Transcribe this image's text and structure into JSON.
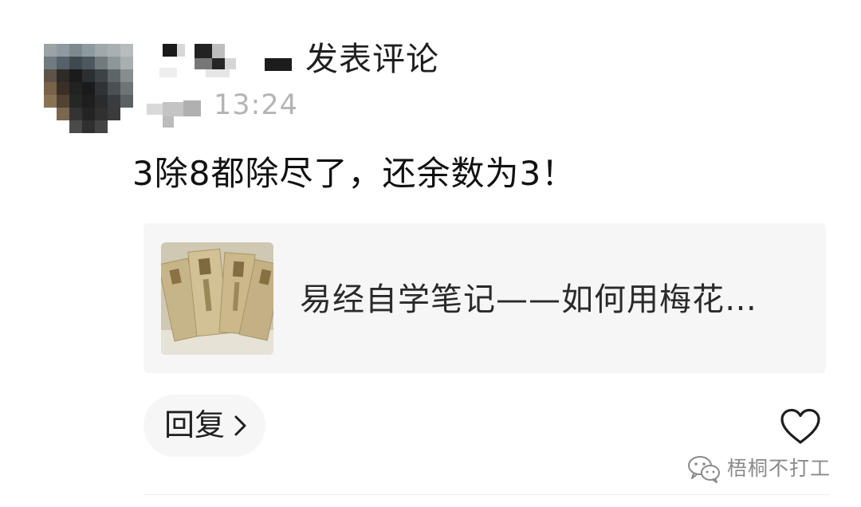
{
  "comment": {
    "action": "发表评论",
    "time": "13:24",
    "text": "3除8都除尽了，还余数为3！"
  },
  "article": {
    "title": "易经自学笔记——如何用梅花…",
    "thumbnail_icon": "booklet-photo-thumbnail"
  },
  "reply": {
    "label": "回复"
  },
  "icons": {
    "like": "heart-outline-icon",
    "chevron": "chevron-right-icon",
    "watermark": "wechat-icon"
  },
  "watermark": {
    "text": "梧桐不打工"
  },
  "colors": {
    "card_background": "#f6f6f6",
    "timestamp": "#b4b4b4",
    "text_primary": "#111111"
  }
}
